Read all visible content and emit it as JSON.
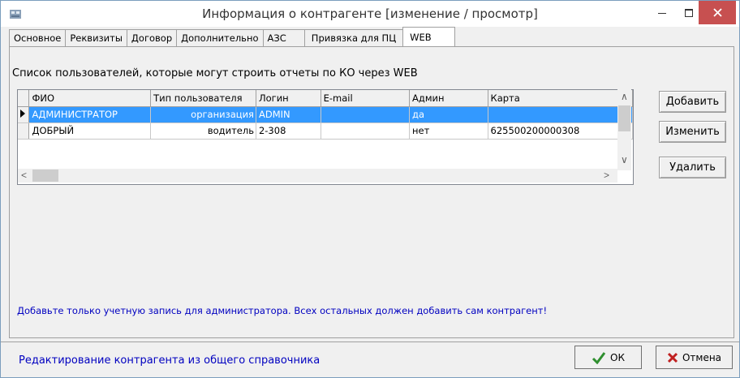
{
  "window": {
    "title": "Информация о контрагенте [изменение / просмотр]"
  },
  "tabs": [
    {
      "label": "Основное"
    },
    {
      "label": "Реквизиты"
    },
    {
      "label": "Договор"
    },
    {
      "label": "Дополнительно"
    },
    {
      "label": "АЗС"
    },
    {
      "label": "Привязка для ПЦ"
    },
    {
      "label": "WEB",
      "active": true
    }
  ],
  "web_tab": {
    "list_caption": "Список пользователей, которые могут строить отчеты по КО через WEB",
    "columns": [
      "ФИО",
      "Тип пользователя",
      "Логин",
      "E-mail",
      "Админ",
      "Карта"
    ],
    "rows": [
      {
        "fio": "АДМИНИСТРАТОР",
        "type": "организация",
        "login": "ADMIN",
        "email": "",
        "admin": "да",
        "card": "",
        "selected": true
      },
      {
        "fio": "ДОБРЫЙ",
        "type": "водитель",
        "login": "2-308",
        "email": "",
        "admin": "нет",
        "card": "625500200000308",
        "selected": false
      }
    ],
    "buttons": {
      "add": "Добавить",
      "edit": "Изменить",
      "delete": "Удалить"
    },
    "hint": "Добавьте только учетную запись для администратора. Всех остальных должен добавить сам контрагент!"
  },
  "status_text": "Редактирование контрагента из общего справочника",
  "dialog_buttons": {
    "ok": "ОК",
    "cancel": "Отмена"
  },
  "colors": {
    "selection": "#3399ff",
    "close_button": "#c75050",
    "hint_text": "#0000c0"
  }
}
